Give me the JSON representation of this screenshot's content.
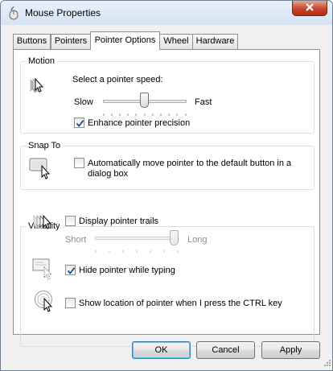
{
  "window": {
    "title": "Mouse Properties",
    "icon": "mouse-icon",
    "close_icon": "close-icon"
  },
  "tabs": [
    {
      "label": "Buttons",
      "active": false
    },
    {
      "label": "Pointers",
      "active": false
    },
    {
      "label": "Pointer Options",
      "active": true
    },
    {
      "label": "Wheel",
      "active": false
    },
    {
      "label": "Hardware",
      "active": false
    }
  ],
  "motion": {
    "group_label": "Motion",
    "icon": "pointer-speed-icon",
    "speed_label": "Select a pointer speed:",
    "slow_label": "Slow",
    "fast_label": "Fast",
    "speed_level": 0.5,
    "precision_label": "Enhance pointer precision",
    "precision_checked": true
  },
  "snap_to": {
    "group_label": "Snap To",
    "icon": "snap-to-button-icon",
    "snap_label_line1": "Automatically move pointer to the default button in a",
    "snap_label_line2": "dialog box",
    "snap_checked": false
  },
  "visibility": {
    "group_label": "Visibility",
    "trails_icon": "pointer-trails-icon",
    "trails_label": "Display pointer trails",
    "trails_checked": false,
    "short_label": "Short",
    "long_label": "Long",
    "trails_level": 1.0,
    "hide_icon": "hide-while-typing-icon",
    "hide_label": "Hide pointer while typing",
    "hide_checked": true,
    "ctrl_icon": "show-location-icon",
    "ctrl_label": "Show location of pointer when I press the CTRL key",
    "ctrl_checked": false
  },
  "buttons": {
    "ok": "OK",
    "cancel": "Cancel",
    "apply": "Apply"
  }
}
